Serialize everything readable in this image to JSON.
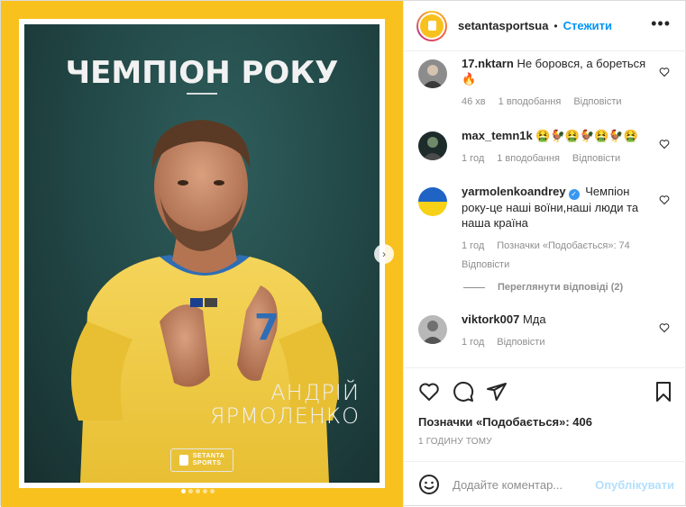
{
  "header": {
    "username": "setantasportsua",
    "bullet": "•",
    "follow_label": "Стежити",
    "more_icon": "more-dots-icon",
    "more_glyph": "•••"
  },
  "poster": {
    "title": "ЧЕМПІОН РОКУ",
    "name_line1": "АНДРІЙ",
    "name_line2": "ЯРМОЛЕНКО",
    "logo_line1": "SETANTA",
    "logo_line2": "SPORTS",
    "background_color": "#f9c11e",
    "carousel_total": 5,
    "carousel_active": 1
  },
  "comments": [
    {
      "user": "17.nktarn",
      "text": "Не боровся, а бореться 🔥",
      "time": "46 хв",
      "likes": "1 вподобання",
      "reply": "Відповісти"
    },
    {
      "user": "max_temn1k",
      "text": "🤮🐓🤮🐓🤮🐓🤮",
      "time": "1 год",
      "likes": "1 вподобання",
      "reply": "Відповісти"
    },
    {
      "user": "yarmolenkoandrey",
      "verified": true,
      "text": "Чемпіон року-це наші воїни,наші люди та наша країна",
      "time": "1 год",
      "likes": "Позначки «Подобається»: 74",
      "reply": "Відповісти"
    },
    {
      "user": "viktork007",
      "text": "Мда",
      "time": "1 год",
      "reply": "Відповісти"
    }
  ],
  "view_replies": "Переглянути відповіді (2)",
  "actions": {
    "like_icon": "heart-icon",
    "comment_icon": "comment-icon",
    "share_icon": "share-icon",
    "save_icon": "bookmark-icon"
  },
  "likes_text": "Позначки «Подобається»: 406",
  "time_ago": "1 ГОДИНУ ТОМУ",
  "add_comment": {
    "placeholder": "Додайте коментар...",
    "publish_label": "Опублікувати"
  },
  "colors": {
    "accent": "#0095f6",
    "publish_disabled": "#b2dffc",
    "muted": "#8e8e8e"
  }
}
